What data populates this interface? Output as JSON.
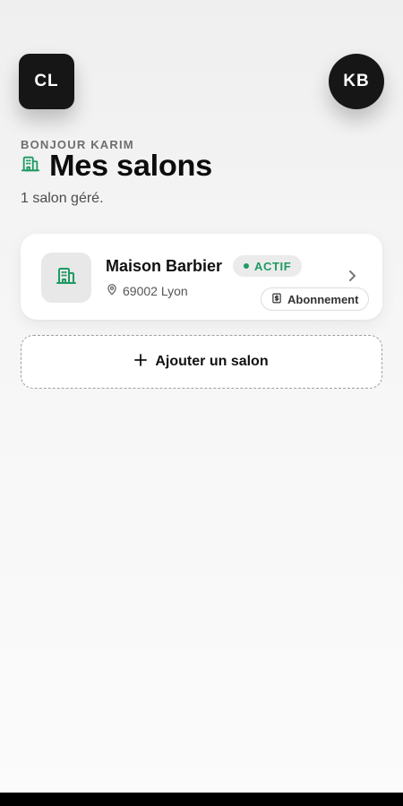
{
  "header": {
    "app_badge": "CL",
    "user_initials": "KB"
  },
  "greeting": "BONJOUR KARIM",
  "title": "Mes salons",
  "subtitle": "1 salon géré.",
  "salons": [
    {
      "name": "Maison Barbier",
      "status": "ACTIF",
      "location": "69002 Lyon",
      "subscription_label": "Abonnement"
    }
  ],
  "add_salon_label": "Ajouter un salon",
  "icons": {
    "title": "building-icon",
    "salon_thumb": "building-icon",
    "location": "map-pin-icon",
    "chevron": "chevron-right-icon",
    "subscription": "receipt-icon",
    "add": "plus-icon"
  },
  "colors": {
    "accent": "#1e9a64",
    "dark": "#161616",
    "status_bg": "#ebebeb"
  }
}
